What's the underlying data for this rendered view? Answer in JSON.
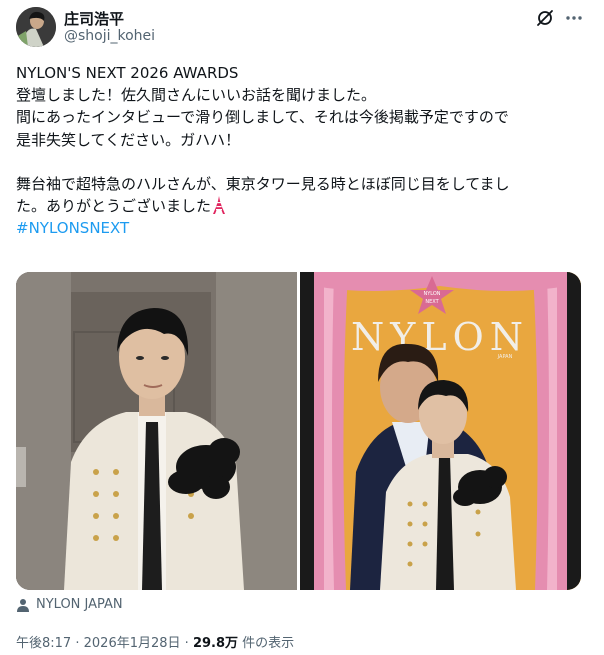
{
  "author": {
    "display_name": "庄司浩平",
    "handle": "@shoji_kohei"
  },
  "header_icons": {
    "grok": "grok-slash-icon",
    "more": "more-horizontal-icon"
  },
  "tweet": {
    "lines": [
      "NYLON'S NEXT 2026 AWARDS",
      "登壇しました！佐久間さんにいいお話を聞けました。",
      "間にあったインタビューで滑り倒しまして、それは今後掲載予定ですので",
      "是非失笑してください。ガハハ！",
      "舞台袖で超特急のハルさんが、東京タワー見る時とほぼ同じ目をしてまし",
      "た。ありがとうございました"
    ],
    "emoji": "tokyo-tower-icon",
    "hashtag": "#NYLONSNEXT"
  },
  "media": {
    "photos": [
      {
        "description": "man-in-white-jacket-photo"
      },
      {
        "description": "nylon-cover-backdrop-photo"
      }
    ],
    "credit": "NYLON JAPAN",
    "credit_icon": "person-icon",
    "magazine_logo": "NYLON",
    "magazine_sub": "JAPAN",
    "badge_top": "NYLON",
    "badge_bottom": "NEXT"
  },
  "meta": {
    "time": "午後8:17",
    "separator": "·",
    "date": "2026年1月28日",
    "views_count": "29.8万",
    "views_label": " 件の表示"
  },
  "colors": {
    "text": "#0f1419",
    "secondary": "#536471",
    "link": "#1d9bf0",
    "curtain": "#e58db0",
    "backdrop": "#e8a63d"
  }
}
